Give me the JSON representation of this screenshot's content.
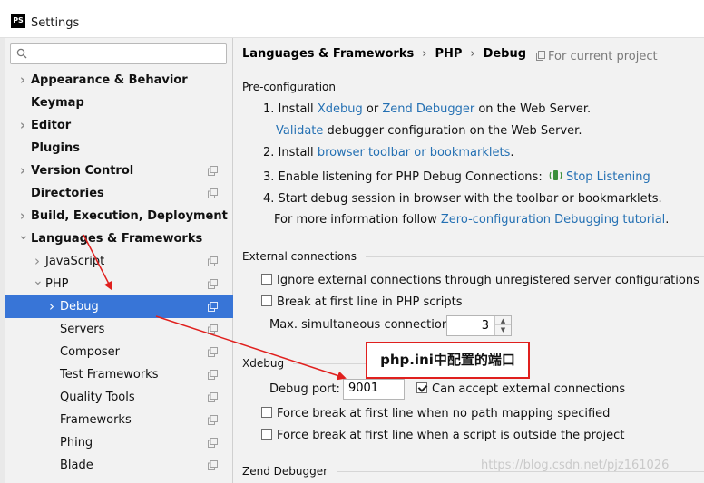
{
  "window": {
    "title": "Settings",
    "logo_text": "PS"
  },
  "search": {
    "placeholder": ""
  },
  "sidebar": {
    "items": [
      {
        "label": "Appearance & Behavior",
        "level": 0,
        "bold": true,
        "arrow": "right",
        "project_icon": false
      },
      {
        "label": "Keymap",
        "level": 0,
        "bold": true,
        "arrow": "",
        "project_icon": false
      },
      {
        "label": "Editor",
        "level": 0,
        "bold": true,
        "arrow": "right",
        "project_icon": false
      },
      {
        "label": "Plugins",
        "level": 0,
        "bold": true,
        "arrow": "",
        "project_icon": false
      },
      {
        "label": "Version Control",
        "level": 0,
        "bold": true,
        "arrow": "right",
        "project_icon": true
      },
      {
        "label": "Directories",
        "level": 0,
        "bold": true,
        "arrow": "",
        "project_icon": true
      },
      {
        "label": "Build, Execution, Deployment",
        "level": 0,
        "bold": true,
        "arrow": "right",
        "project_icon": false
      },
      {
        "label": "Languages & Frameworks",
        "level": 0,
        "bold": true,
        "arrow": "down",
        "project_icon": false
      },
      {
        "label": "JavaScript",
        "level": 1,
        "bold": false,
        "arrow": "right",
        "project_icon": true
      },
      {
        "label": "PHP",
        "level": 1,
        "bold": false,
        "arrow": "down",
        "project_icon": true
      },
      {
        "label": "Debug",
        "level": 2,
        "bold": false,
        "arrow": "right",
        "project_icon": true,
        "selected": true
      },
      {
        "label": "Servers",
        "level": 2,
        "bold": false,
        "arrow": "",
        "project_icon": true
      },
      {
        "label": "Composer",
        "level": 2,
        "bold": false,
        "arrow": "",
        "project_icon": true
      },
      {
        "label": "Test Frameworks",
        "level": 2,
        "bold": false,
        "arrow": "",
        "project_icon": true
      },
      {
        "label": "Quality Tools",
        "level": 2,
        "bold": false,
        "arrow": "",
        "project_icon": true
      },
      {
        "label": "Frameworks",
        "level": 2,
        "bold": false,
        "arrow": "",
        "project_icon": true
      },
      {
        "label": "Phing",
        "level": 2,
        "bold": false,
        "arrow": "",
        "project_icon": true
      },
      {
        "label": "Blade",
        "level": 2,
        "bold": false,
        "arrow": "",
        "project_icon": true
      }
    ]
  },
  "breadcrumb": {
    "part1": "Languages & Frameworks",
    "sep": "›",
    "part2": "PHP",
    "part3": "Debug"
  },
  "for_project": "For current project",
  "preconfig": {
    "title": "Pre-configuration",
    "step1_prefix": "1. Install",
    "xdebug_link": "Xdebug",
    "or": "or",
    "zend_link": "Zend Debugger",
    "step1_suffix": "on the Web Server.",
    "validate_link": "Validate",
    "validate_suffix": "debugger configuration on the Web Server.",
    "step2_prefix": "2. Install",
    "toolbar_link": "browser toolbar or bookmarklets",
    "step2_suffix": ".",
    "step3_prefix": "3. Enable listening for PHP Debug Connections:",
    "stop_listening_link": "Stop Listening",
    "step4": "4. Start debug session in browser with the toolbar or bookmarklets.",
    "more_info_prefix": "For more information follow",
    "tutorial_link": "Zero-configuration Debugging tutorial",
    "more_info_suffix": "."
  },
  "external": {
    "title": "External connections",
    "ignore_label": "Ignore external connections through unregistered server configurations",
    "ignore_checked": false,
    "break_first_label": "Break at first line in PHP scripts",
    "break_first_checked": false,
    "max_label": "Max. simultaneous connections:",
    "max_value": "3"
  },
  "xdebug": {
    "title": "Xdebug",
    "port_label": "Debug port:",
    "port_value": "9001",
    "accept_label": "Can accept external connections",
    "accept_checked": true,
    "force_no_mapping_label": "Force break at first line when no path mapping specified",
    "force_no_mapping_checked": false,
    "force_outside_label": "Force break at first line when a script is outside the project",
    "force_outside_checked": false
  },
  "zend": {
    "title": "Zend Debugger"
  },
  "annotation": {
    "text": "php.ini中配置的端口",
    "color": "#e0201e"
  },
  "watermark": "https://blog.csdn.net/pjz161026",
  "colors": {
    "selection": "#3875d7",
    "link": "#2470b3",
    "annotation_red": "#e0201e"
  }
}
